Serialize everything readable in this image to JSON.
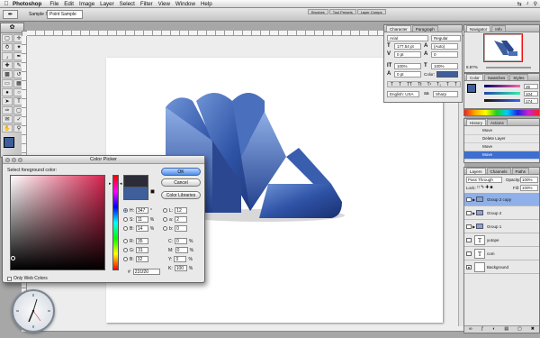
{
  "menubar": {
    "app": "Photoshop",
    "items": [
      "File",
      "Edit",
      "Image",
      "Layer",
      "Select",
      "Filter",
      "View",
      "Window",
      "Help"
    ]
  },
  "options": {
    "sample_label": "Sample Size:",
    "sample_value": "Point Sample"
  },
  "wells": [
    "Brushes",
    "Tool Presets",
    "Layer Comps"
  ],
  "character": {
    "tabs": [
      "Character",
      "Paragraph"
    ],
    "font": "Arial",
    "style": "Regular",
    "size": "177.54 pt",
    "leading": "(Auto)",
    "kerning": "0 pt",
    "vscale": "100%",
    "hscale": "100%",
    "tracking": "0",
    "baseline": "0 pt",
    "color_label": "Color:",
    "language": "English: USA",
    "aa": "Sharp"
  },
  "navigator": {
    "tabs": [
      "Navigator",
      "Info"
    ],
    "zoom": "8.87%"
  },
  "color": {
    "tabs": [
      "Color",
      "Swatches",
      "Styles"
    ],
    "r": "35",
    "g": "104",
    "b": "174"
  },
  "history": {
    "tabs": [
      "History",
      "Actions"
    ],
    "items": [
      "Move",
      "Delete Layer",
      "Move",
      "Move"
    ]
  },
  "layers": {
    "tabs": [
      "Layers",
      "Channels",
      "Paths"
    ],
    "blend": "Pass Through",
    "opacity_label": "Opacity:",
    "opacity": "100%",
    "lock_label": "Lock:",
    "fill_label": "Fill:",
    "fill": "100%",
    "rows": [
      {
        "name": "Group 2 copy",
        "kind": "group"
      },
      {
        "name": "Group 2",
        "kind": "group"
      },
      {
        "name": "Group 1",
        "kind": "group"
      },
      {
        "name": "yutope",
        "kind": "text"
      },
      {
        "name": "com",
        "kind": "text"
      },
      {
        "name": "Background",
        "kind": "bg"
      }
    ]
  },
  "picker": {
    "title": "Color Picker",
    "prompt": "Select foreground color:",
    "ok": "OK",
    "cancel": "Cancel",
    "libraries": "Color Libraries",
    "h": "347",
    "s": "11",
    "b": "14",
    "r": "35",
    "g": "31",
    "bb": "32",
    "l": "12",
    "a": "2",
    "b2": "0",
    "c": "0",
    "m": "0",
    "y": "0",
    "k": "100",
    "hex": "231f20",
    "web_only": "Only Web Colors",
    "deg": "°",
    "pct": "%"
  },
  "colors": {
    "accent": "#3e5f9c",
    "logo_dark": "#1f3c86",
    "logo_light": "#6f94d6",
    "selection": "#3c6fd0"
  }
}
